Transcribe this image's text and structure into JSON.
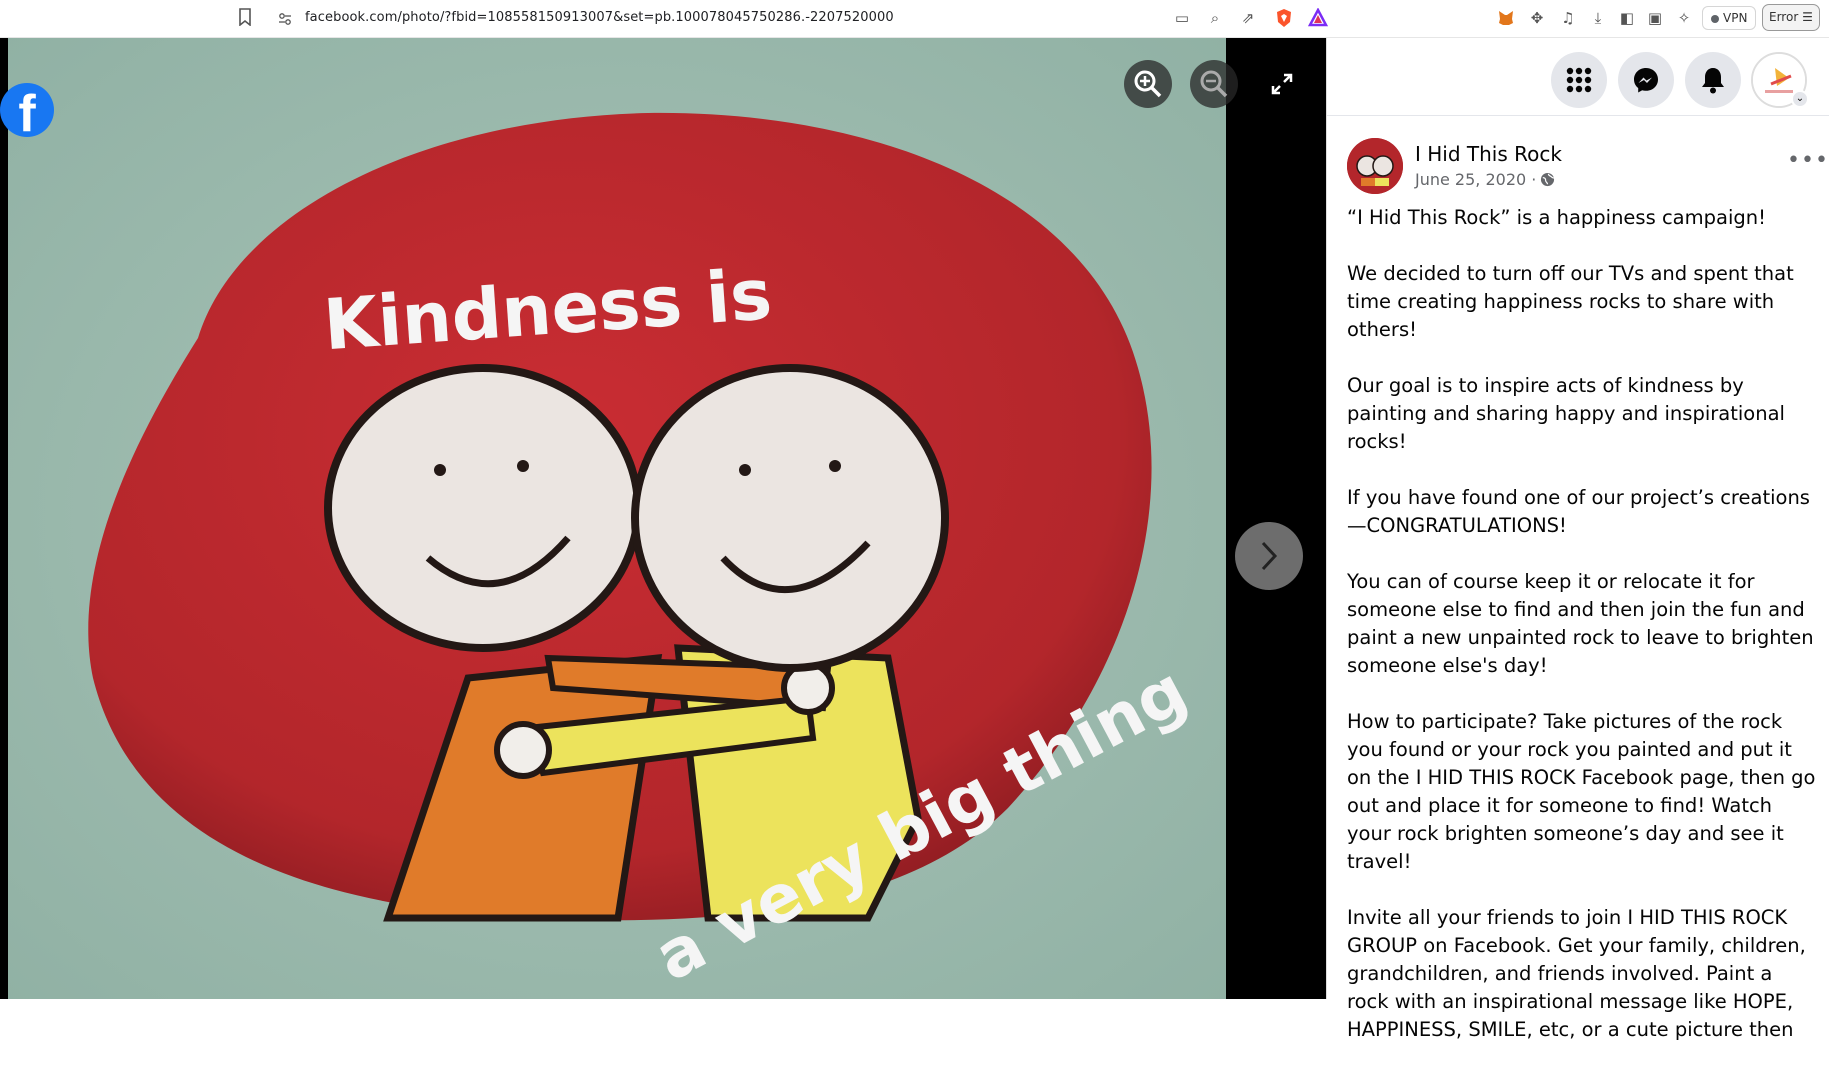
{
  "browser": {
    "url": "facebook.com/photo/?fbid=108558150913007&set=pb.100078045750286.-2207520000",
    "vpn_label": "VPN",
    "error_label": "Error"
  },
  "viewer": {
    "photo_text_top": "Kindness is",
    "photo_text_bottom": "a very big thing"
  },
  "post": {
    "page_name": "I Hid This Rock",
    "date": "June 25, 2020 ·",
    "paragraphs": [
      "“I Hid This Rock” is a happiness campaign!",
      "We decided to turn off our TVs and spent that time creating happiness rocks to share with others!",
      "Our goal is to inspire acts of kindness by painting and sharing happy and inspirational rocks!",
      "If you have found one of our project’s creations—CONGRATULATIONS!",
      "You can of course keep it or relocate it for someone else to find and then join the fun and paint a new unpainted rock to leave to brighten someone else's day!",
      "How to participate? Take pictures of the rock you found or your rock you painted and put it on the I HID THIS ROCK Facebook page, then go out and place it for someone to find! Watch your rock brighten someone’s day and see it travel!",
      "Invite all your friends to join I HID THIS ROCK GROUP on Facebook. Get your family, children, grandchildren, and friends involved. Paint a rock with an inspirational message like HOPE, HAPPINESS, SMILE, etc, or a cute picture then"
    ]
  },
  "colors": {
    "facebook_blue": "#1877f2",
    "rock_red": "#b3262b"
  }
}
